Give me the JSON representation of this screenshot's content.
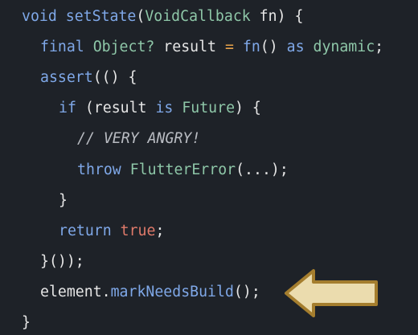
{
  "colors": {
    "background": "#1e2228",
    "keyword": "#7fa8e8",
    "type": "#8ec7a8",
    "operator": "#e7a24a",
    "literal": "#e07a6a",
    "comment": "#b9bcc2",
    "text": "#e6e6e6",
    "arrow_fill": "#ebdcae",
    "arrow_stroke": "#a57e2e"
  },
  "code": {
    "language": "dart",
    "lines": [
      {
        "indent": 0,
        "tokens": [
          {
            "text": "void",
            "kind": "keyword"
          },
          {
            "text": " ",
            "kind": "space"
          },
          {
            "text": "setState",
            "kind": "function"
          },
          {
            "text": "(",
            "kind": "punct"
          },
          {
            "text": "VoidCallback",
            "kind": "type"
          },
          {
            "text": " fn) {",
            "kind": "punct"
          }
        ]
      },
      {
        "indent": 1,
        "tokens": [
          {
            "text": "final",
            "kind": "keyword"
          },
          {
            "text": " ",
            "kind": "space"
          },
          {
            "text": "Object?",
            "kind": "type"
          },
          {
            "text": " result ",
            "kind": "ident"
          },
          {
            "text": "=",
            "kind": "operator"
          },
          {
            "text": " ",
            "kind": "space"
          },
          {
            "text": "fn",
            "kind": "function"
          },
          {
            "text": "() ",
            "kind": "punct"
          },
          {
            "text": "as",
            "kind": "keyword"
          },
          {
            "text": " ",
            "kind": "space"
          },
          {
            "text": "dynamic",
            "kind": "type"
          },
          {
            "text": ";",
            "kind": "punct"
          }
        ]
      },
      {
        "indent": 1,
        "tokens": [
          {
            "text": "assert",
            "kind": "function"
          },
          {
            "text": "(() {",
            "kind": "punct"
          }
        ]
      },
      {
        "indent": 2,
        "tokens": [
          {
            "text": "if",
            "kind": "keyword"
          },
          {
            "text": " (result ",
            "kind": "ident"
          },
          {
            "text": "is",
            "kind": "keyword"
          },
          {
            "text": " ",
            "kind": "space"
          },
          {
            "text": "Future",
            "kind": "type"
          },
          {
            "text": ") {",
            "kind": "punct"
          }
        ]
      },
      {
        "indent": 3,
        "tokens": [
          {
            "text": "// VERY ANGRY!",
            "kind": "comment"
          }
        ]
      },
      {
        "indent": 3,
        "tokens": [
          {
            "text": "throw",
            "kind": "keyword"
          },
          {
            "text": " ",
            "kind": "space"
          },
          {
            "text": "FlutterError",
            "kind": "type"
          },
          {
            "text": "(...);",
            "kind": "punct"
          }
        ]
      },
      {
        "indent": 2,
        "tokens": [
          {
            "text": "}",
            "kind": "punct"
          }
        ]
      },
      {
        "indent": 2,
        "tokens": [
          {
            "text": "return",
            "kind": "keyword"
          },
          {
            "text": " ",
            "kind": "space"
          },
          {
            "text": "true",
            "kind": "literal"
          },
          {
            "text": ";",
            "kind": "punct"
          }
        ]
      },
      {
        "indent": 1,
        "tokens": [
          {
            "text": "}());",
            "kind": "punct"
          }
        ]
      },
      {
        "indent": 1,
        "tokens": [
          {
            "text": "element.",
            "kind": "ident"
          },
          {
            "text": "markNeedsBuild",
            "kind": "function"
          },
          {
            "text": "();",
            "kind": "punct"
          }
        ]
      },
      {
        "indent": 0,
        "tokens": [
          {
            "text": "}",
            "kind": "punct"
          }
        ]
      }
    ]
  },
  "highlight_arrow": {
    "icon": "left-arrow-icon",
    "points_to_line": 10
  }
}
